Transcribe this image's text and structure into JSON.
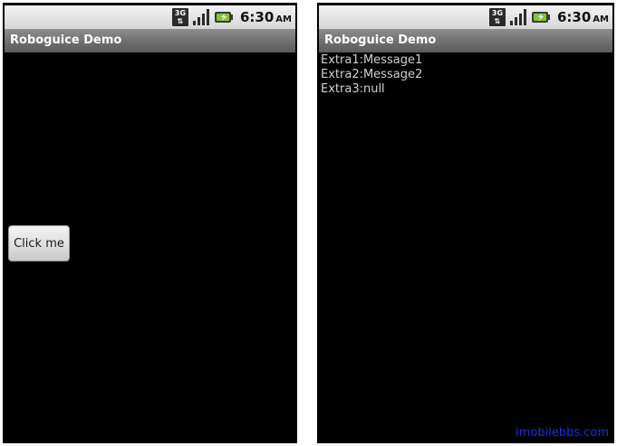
{
  "screens": [
    {
      "status_bar": {
        "network_icon": "3g-icon",
        "network_label_top": "3G",
        "network_label_bottom": "⇅",
        "signal_icon": "signal-bars-icon",
        "battery_icon": "battery-charging-icon",
        "time": "6:30",
        "ampm": "AM"
      },
      "title": "Roboguice Demo",
      "button_label": "Click me"
    },
    {
      "status_bar": {
        "network_icon": "3g-icon",
        "network_label_top": "3G",
        "network_label_bottom": "⇅",
        "signal_icon": "signal-bars-icon",
        "battery_icon": "battery-charging-icon",
        "time": "6:30",
        "ampm": "AM"
      },
      "title": "Roboguice Demo",
      "extras": [
        "Extra1:Message1",
        "Extra2:Message2",
        "Extra3:null"
      ]
    }
  ],
  "watermark": "imobilebbs.com",
  "colors": {
    "status_bar": "#e4e4e4",
    "title_bar": "#767676",
    "background": "#000000",
    "text": "#cfcfcf",
    "watermark": "#1f2fd9"
  }
}
